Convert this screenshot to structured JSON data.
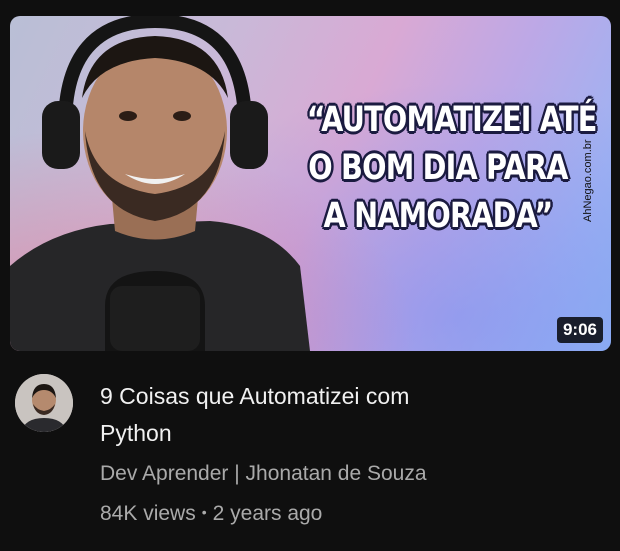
{
  "video": {
    "thumbnail_text": [
      "“AUTOMATIZEI ATÉ",
      "O BOM DIA PARA",
      "A NAMORADA”"
    ],
    "duration": "9:06",
    "title_lines": [
      "9 Coisas que Automatizei com",
      "Python"
    ],
    "channel": "Dev Aprender | Jhonatan de Souza",
    "views": "84K views",
    "age": "2 years ago"
  },
  "watermark": "AhNegao.com.br",
  "colors": {
    "background": "#0f0f0f",
    "title": "#f1f1f1",
    "secondary_text": "#aaaaaa",
    "thumbnail_outline": "#1b1b40"
  }
}
